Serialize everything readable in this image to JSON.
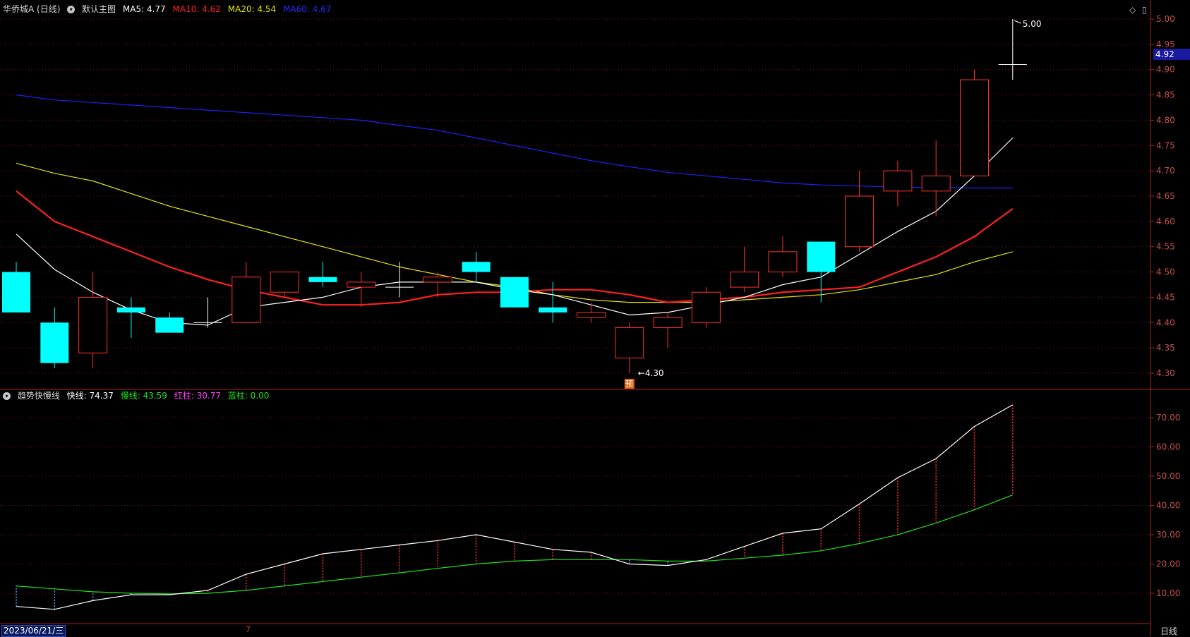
{
  "main_header": {
    "stock_name": "华侨城A (日线)",
    "indicator_name": "默认主图",
    "ma": [
      {
        "label": "MA5: 4.77",
        "color": "#ffffff"
      },
      {
        "label": "MA10: 4.62",
        "color": "#ff2020"
      },
      {
        "label": "MA20: 4.54",
        "color": "#e6e600"
      },
      {
        "label": "MA60: 4.67",
        "color": "#2020ff"
      }
    ]
  },
  "sub_header": {
    "indicator_name": "趋势快慢线",
    "values": [
      {
        "label": "快线: 74.37",
        "color": "#ffffff"
      },
      {
        "label": "慢线: 43.59",
        "color": "#20e020"
      },
      {
        "label": "红柱: 30.77",
        "color": "#ff40ff"
      },
      {
        "label": "蓝柱: 0.00",
        "color": "#20e020"
      }
    ]
  },
  "price_axis": [
    "5.00",
    "4.95",
    "4.90",
    "4.85",
    "4.80",
    "4.75",
    "4.70",
    "4.65",
    "4.60",
    "4.55",
    "4.50",
    "4.45",
    "4.40",
    "4.35",
    "4.30"
  ],
  "sub_axis": [
    "70.00",
    "60.00",
    "50.00",
    "40.00",
    "30.00",
    "20.00",
    "10.00"
  ],
  "current_price": "4.92",
  "high_label": "5.00",
  "low_label": "4.30",
  "forecast_label": "预",
  "date_label": "2023/06/21/三",
  "marker_label": "7",
  "period_label": "日线",
  "chart_data": {
    "type": "candlestick",
    "candles": [
      {
        "o": 4.5,
        "h": 4.52,
        "l": 4.42,
        "c": 4.42
      },
      {
        "o": 4.4,
        "h": 4.43,
        "l": 4.31,
        "c": 4.32
      },
      {
        "o": 4.34,
        "h": 4.5,
        "l": 4.31,
        "c": 4.45
      },
      {
        "o": 4.43,
        "h": 4.45,
        "l": 4.37,
        "c": 4.42
      },
      {
        "o": 4.41,
        "h": 4.42,
        "l": 4.38,
        "c": 4.38
      },
      {
        "o": 4.4,
        "h": 4.45,
        "l": 4.39,
        "c": 4.4
      },
      {
        "o": 4.4,
        "h": 4.52,
        "l": 4.4,
        "c": 4.49
      },
      {
        "o": 4.46,
        "h": 4.5,
        "l": 4.45,
        "c": 4.5
      },
      {
        "o": 4.49,
        "h": 4.52,
        "l": 4.47,
        "c": 4.48
      },
      {
        "o": 4.47,
        "h": 4.5,
        "l": 4.43,
        "c": 4.48
      },
      {
        "o": 4.47,
        "h": 4.52,
        "l": 4.45,
        "c": 4.47
      },
      {
        "o": 4.48,
        "h": 4.5,
        "l": 4.45,
        "c": 4.49
      },
      {
        "o": 4.52,
        "h": 4.54,
        "l": 4.48,
        "c": 4.5
      },
      {
        "o": 4.49,
        "h": 4.49,
        "l": 4.43,
        "c": 4.43
      },
      {
        "o": 4.43,
        "h": 4.48,
        "l": 4.4,
        "c": 4.42
      },
      {
        "o": 4.41,
        "h": 4.44,
        "l": 4.4,
        "c": 4.42
      },
      {
        "o": 4.33,
        "h": 4.4,
        "l": 4.3,
        "c": 4.39
      },
      {
        "o": 4.39,
        "h": 4.42,
        "l": 4.35,
        "c": 4.41
      },
      {
        "o": 4.4,
        "h": 4.47,
        "l": 4.39,
        "c": 4.46
      },
      {
        "o": 4.47,
        "h": 4.55,
        "l": 4.46,
        "c": 4.5
      },
      {
        "o": 4.5,
        "h": 4.57,
        "l": 4.49,
        "c": 4.54
      },
      {
        "o": 4.56,
        "h": 4.56,
        "l": 4.44,
        "c": 4.5
      },
      {
        "o": 4.55,
        "h": 4.7,
        "l": 4.54,
        "c": 4.65
      },
      {
        "o": 4.66,
        "h": 4.72,
        "l": 4.63,
        "c": 4.7
      },
      {
        "o": 4.66,
        "h": 4.76,
        "l": 4.61,
        "c": 4.69
      },
      {
        "o": 4.69,
        "h": 4.9,
        "l": 4.69,
        "c": 4.88
      },
      {
        "o": 4.91,
        "h": 5.0,
        "l": 4.88,
        "c": 4.91
      }
    ],
    "ma5": [
      4.575,
      4.505,
      4.46,
      4.425,
      4.4,
      4.395,
      4.43,
      4.44,
      4.45,
      4.47,
      4.48,
      4.48,
      4.48,
      4.465,
      4.455,
      4.435,
      4.415,
      4.42,
      4.435,
      4.45,
      4.475,
      4.49,
      4.535,
      4.58,
      4.62,
      4.69,
      4.765
    ],
    "ma10": [
      4.66,
      4.6,
      4.57,
      4.54,
      4.51,
      4.485,
      4.465,
      4.45,
      4.435,
      4.435,
      4.44,
      4.455,
      4.46,
      4.46,
      4.465,
      4.465,
      4.455,
      4.44,
      4.445,
      4.45,
      4.46,
      4.465,
      4.47,
      4.5,
      4.53,
      4.57,
      4.625
    ],
    "ma20": [
      4.715,
      4.695,
      4.68,
      4.655,
      4.63,
      4.61,
      4.59,
      4.57,
      4.55,
      4.53,
      4.51,
      4.495,
      4.48,
      4.47,
      4.455,
      4.445,
      4.44,
      4.44,
      4.44,
      4.445,
      4.45,
      4.455,
      4.465,
      4.48,
      4.495,
      4.52,
      4.54
    ],
    "ma60": [
      4.85,
      4.84,
      4.835,
      4.83,
      4.825,
      4.82,
      4.815,
      4.81,
      4.805,
      4.8,
      4.79,
      4.78,
      4.765,
      4.75,
      4.735,
      4.72,
      4.708,
      4.697,
      4.69,
      4.683,
      4.676,
      4.672,
      4.67,
      4.668,
      4.667,
      4.666,
      4.666
    ],
    "fast": [
      5.5,
      4.5,
      7.5,
      9.5,
      9.5,
      11,
      16.5,
      20,
      23.5,
      25,
      26.5,
      28,
      30,
      27.5,
      25,
      24,
      20,
      19.5,
      21.5,
      26,
      30.5,
      32,
      40.5,
      49.5,
      56,
      67,
      74.37
    ],
    "slow": [
      12.5,
      11.5,
      10.5,
      10,
      9.8,
      10,
      11,
      12.5,
      14,
      15.5,
      17,
      18.5,
      20,
      21,
      21.5,
      21.5,
      21.5,
      21,
      21,
      22,
      23,
      24.5,
      27,
      30,
      34,
      38.5,
      43.59
    ],
    "price_range": [
      4.28,
      5.015
    ],
    "sub_range": [
      0,
      80
    ]
  }
}
